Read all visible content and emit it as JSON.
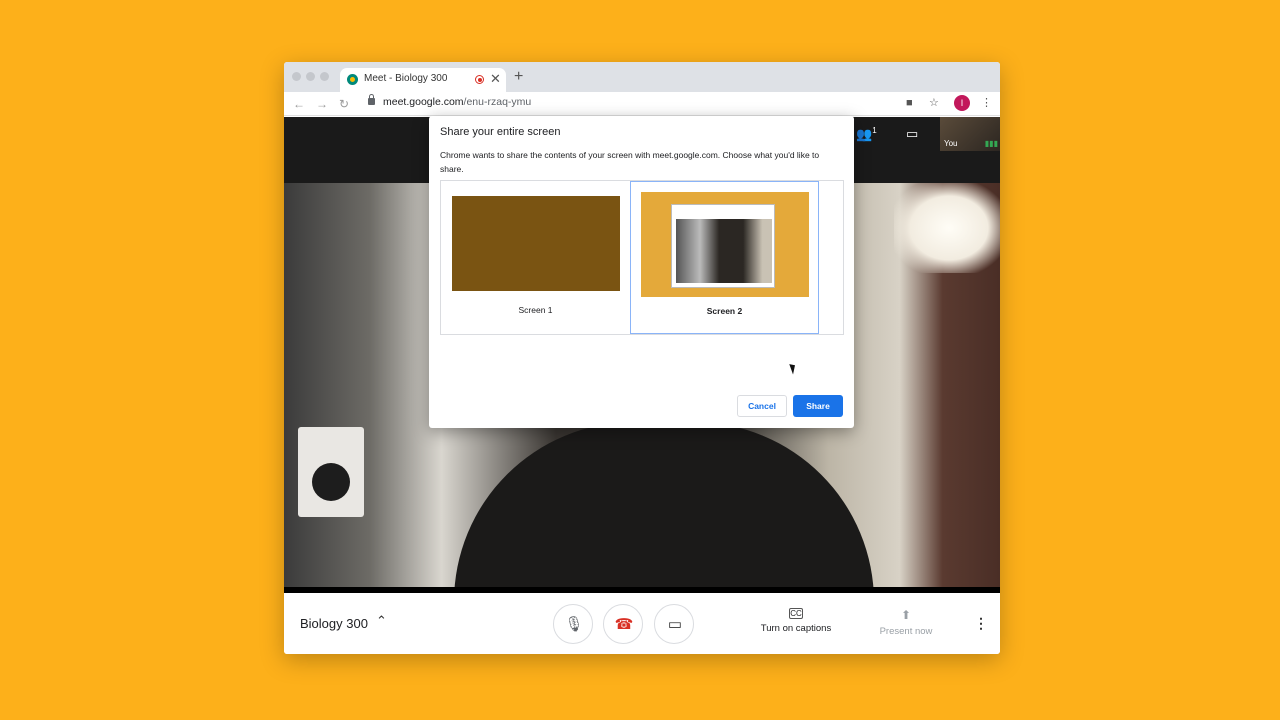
{
  "browser": {
    "tab_title": "Meet - Biology 300",
    "tab_close_glyph": "✕",
    "new_tab_glyph": "+",
    "back_glyph": "←",
    "forward_glyph": "→",
    "reload_glyph": "↻",
    "url_host": "meet.google.com",
    "url_path": "/enu-rzaq-ymu",
    "camera_glyph": "■",
    "star_glyph": "☆",
    "profile_initial": "I",
    "menu_glyph": "⋮"
  },
  "meet": {
    "people_glyph": "👥",
    "people_count": "1",
    "chat_glyph": "▭",
    "self_label": "You",
    "self_audio_glyph": "▮▮▮",
    "meeting_title": "Biology 300",
    "chevron_glyph": "⌃",
    "mic_glyph": "🎙",
    "hangup_glyph": "☎",
    "camera_glyph": "▭",
    "captions_glyph": "CC",
    "captions_label": "Turn on captions",
    "present_glyph": "⬆",
    "present_label": "Present now",
    "more_glyph": "⋮",
    "colors": {
      "hangup": "#d93025",
      "present_disabled": "#9aa0a6"
    }
  },
  "dialog": {
    "title": "Share your entire screen",
    "description": "Chrome wants to share the contents of your screen with meet.google.com. Choose what you'd like to share.",
    "sources": [
      {
        "label": "Screen 1",
        "selected": false
      },
      {
        "label": "Screen 2",
        "selected": true
      }
    ],
    "cancel_label": "Cancel",
    "share_label": "Share",
    "accent_color": "#1a73e8"
  },
  "page": {
    "background_color": "#FDB01A"
  }
}
